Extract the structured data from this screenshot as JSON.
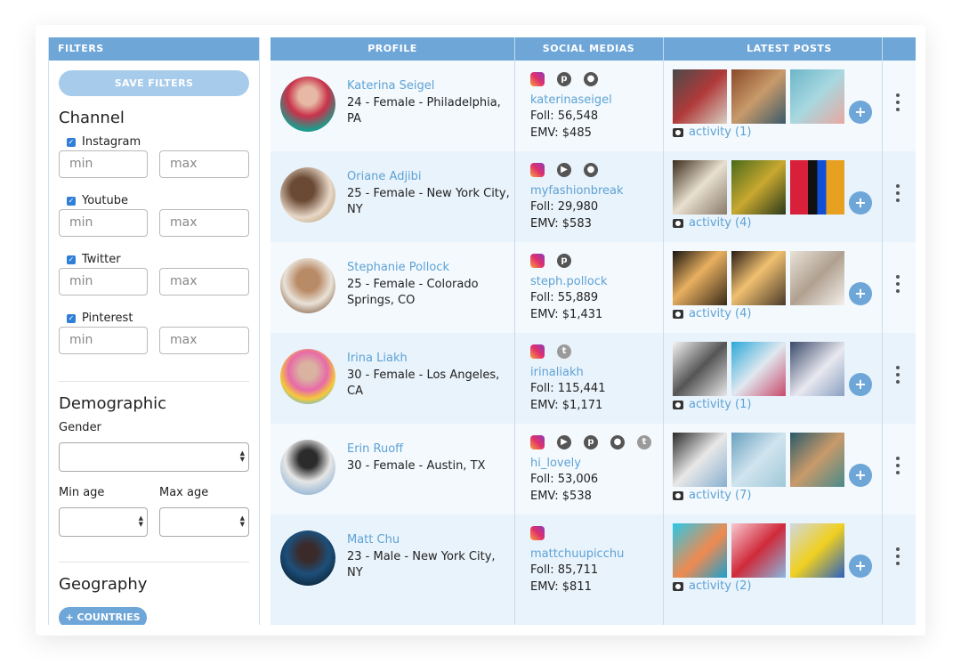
{
  "filters": {
    "header": "FILTERS",
    "save_label": "SAVE FILTERS",
    "channel": {
      "title": "Channel",
      "items": [
        {
          "label": "Instagram",
          "min_placeholder": "min",
          "max_placeholder": "max"
        },
        {
          "label": "Youtube",
          "min_placeholder": "min",
          "max_placeholder": "max"
        },
        {
          "label": "Twitter",
          "min_placeholder": "min",
          "max_placeholder": "max"
        },
        {
          "label": "Pinterest",
          "min_placeholder": "min",
          "max_placeholder": "max"
        }
      ]
    },
    "demographic": {
      "title": "Demographic",
      "gender_label": "Gender",
      "min_age_label": "Min age",
      "max_age_label": "Max age"
    },
    "geography": {
      "title": "Geography",
      "countries_label": "+ COUNTRIES"
    }
  },
  "table": {
    "headers": {
      "profile": "PROFILE",
      "social": "SOCIAL MEDIAS",
      "posts": "LATEST POSTS"
    },
    "rows": [
      {
        "name": "Katerina Seigel",
        "desc": "24 - Female - Philadelphia, PA",
        "handle": "katerinaseigel",
        "foll": "Foll: 56,548",
        "emv": "EMV: $485",
        "activity": "activity (1)",
        "icons": [
          "instagram-icon",
          "pinterest-icon",
          "snapchat-icon"
        ]
      },
      {
        "name": "Oriane Adjibi",
        "desc": "25 - Female - New York City, NY",
        "handle": "myfashionbreak",
        "foll": "Foll: 29,980",
        "emv": "EMV: $583",
        "activity": "activity (4)",
        "icons": [
          "instagram-icon",
          "youtube-icon",
          "snapchat-icon"
        ]
      },
      {
        "name": "Stephanie Pollock",
        "desc": "25 - Female - Colorado Springs, CO",
        "handle": "steph.pollock",
        "foll": "Foll: 55,889",
        "emv": "EMV: $1,431",
        "activity": "activity (4)",
        "icons": [
          "instagram-icon",
          "pinterest-icon"
        ]
      },
      {
        "name": "Irina Liakh",
        "desc": "30 - Female - Los Angeles, CA",
        "handle": "irinaliakh",
        "foll": "Foll: 115,441",
        "emv": "EMV: $1,171",
        "activity": "activity (1)",
        "icons": [
          "instagram-icon",
          "twitter-icon"
        ]
      },
      {
        "name": "Erin Ruoff",
        "desc": "30 - Female - Austin, TX",
        "handle": "hi_lovely",
        "foll": "Foll: 53,006",
        "emv": "EMV: $538",
        "activity": "activity (7)",
        "icons": [
          "instagram-icon",
          "youtube-icon",
          "pinterest-icon",
          "snapchat-icon",
          "twitter-icon"
        ]
      },
      {
        "name": "Matt Chu",
        "desc": "23 - Male - New York City, NY",
        "handle": "mattchuupicchu",
        "foll": "Foll: 85,711",
        "emv": "EMV: $811",
        "activity": "activity (2)",
        "icons": [
          "instagram-icon"
        ]
      }
    ]
  },
  "colors": {
    "accent": "#6ea6d8",
    "link": "#5da2d5",
    "row_alt": "#e9f3fb"
  }
}
